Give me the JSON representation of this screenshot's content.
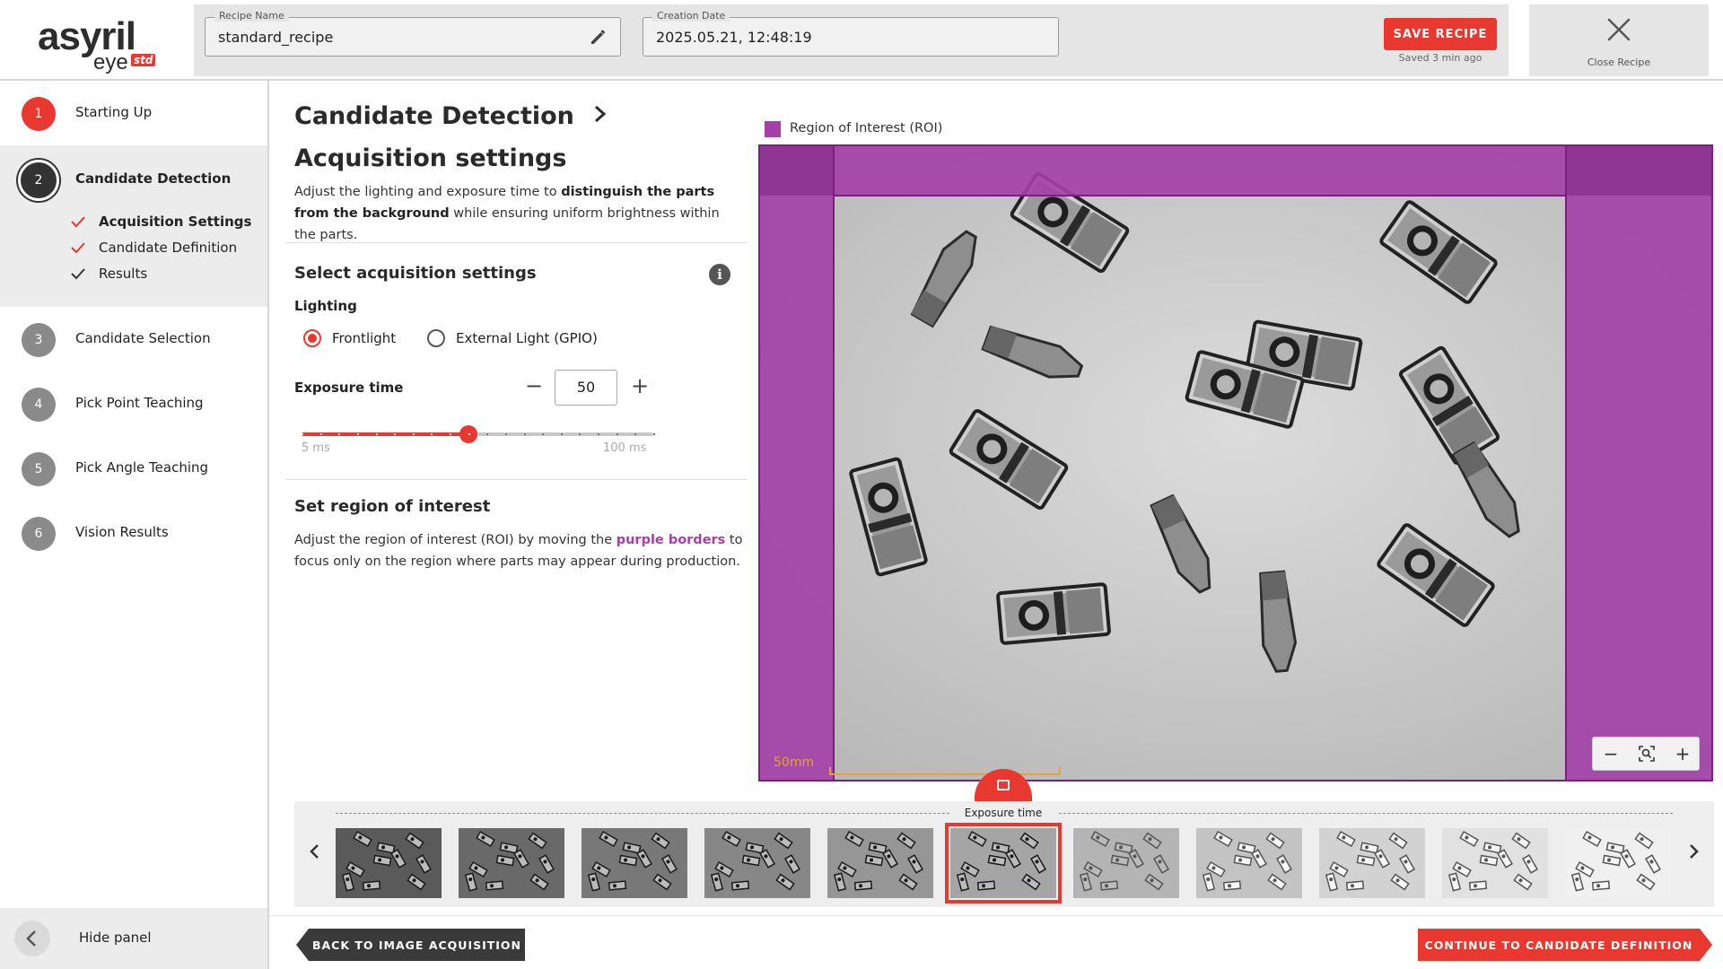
{
  "logo": {
    "brand": "asyril",
    "product": "eye",
    "edition": "std"
  },
  "header": {
    "recipe_name_label": "Recipe Name",
    "recipe_name_value": "standard_recipe",
    "creation_date_label": "Creation Date",
    "creation_date_value": "2025.05.21, 12:48:19",
    "save_label": "SAVE RECIPE",
    "saved_status": "Saved 3 min ago",
    "close_label": "Close Recipe"
  },
  "sidebar": {
    "steps": [
      {
        "num": "1",
        "label": "Starting Up"
      },
      {
        "num": "2",
        "label": "Candidate Detection"
      },
      {
        "num": "3",
        "label": "Candidate Selection"
      },
      {
        "num": "4",
        "label": "Pick Point Teaching"
      },
      {
        "num": "5",
        "label": "Pick Angle Teaching"
      },
      {
        "num": "6",
        "label": "Vision Results"
      }
    ],
    "substeps": [
      {
        "label": "Acquisition Settings"
      },
      {
        "label": "Candidate Definition"
      },
      {
        "label": "Results"
      }
    ],
    "hide_panel": "Hide panel"
  },
  "panel": {
    "title_part1": "Candidate Detection",
    "title_part2": "Acquisition settings",
    "desc_pre": "Adjust the lighting and exposure time to ",
    "desc_bold": "distinguish the parts from the background",
    "desc_post": " while ensuring uniform brightness within the parts.",
    "section_acq": "Select acquisition settings",
    "lighting_label": "Lighting",
    "lighting_options": [
      "Frontlight",
      "External Light (GPIO)"
    ],
    "lighting_selected": 0,
    "exposure_label": "Exposure time",
    "exposure_value": "50",
    "exposure_min": 5,
    "exposure_max": 100,
    "exposure_min_label": "5 ms",
    "exposure_max_label": "100 ms",
    "section_roi": "Set region of interest",
    "roi_pre": "Adjust the region of interest (ROI) by moving the ",
    "roi_purple": "purple borders",
    "roi_post": " to focus only on the region where parts may appear during production."
  },
  "viewer": {
    "legend": "Region of Interest (ROI)",
    "roi_color": "#a341a8",
    "scale_label": "50mm",
    "zoom_out": "−",
    "zoom_in": "+"
  },
  "strip": {
    "caption": "Exposure time",
    "thumb_count": 11,
    "selected_index": 5
  },
  "footer": {
    "back_label": "BACK TO IMAGE ACQUISITION",
    "continue_label": "CONTINUE TO CANDIDATE DEFINITION"
  },
  "colors": {
    "accent": "#e8382f",
    "roi": "#a341a8",
    "dark": "#333333"
  }
}
